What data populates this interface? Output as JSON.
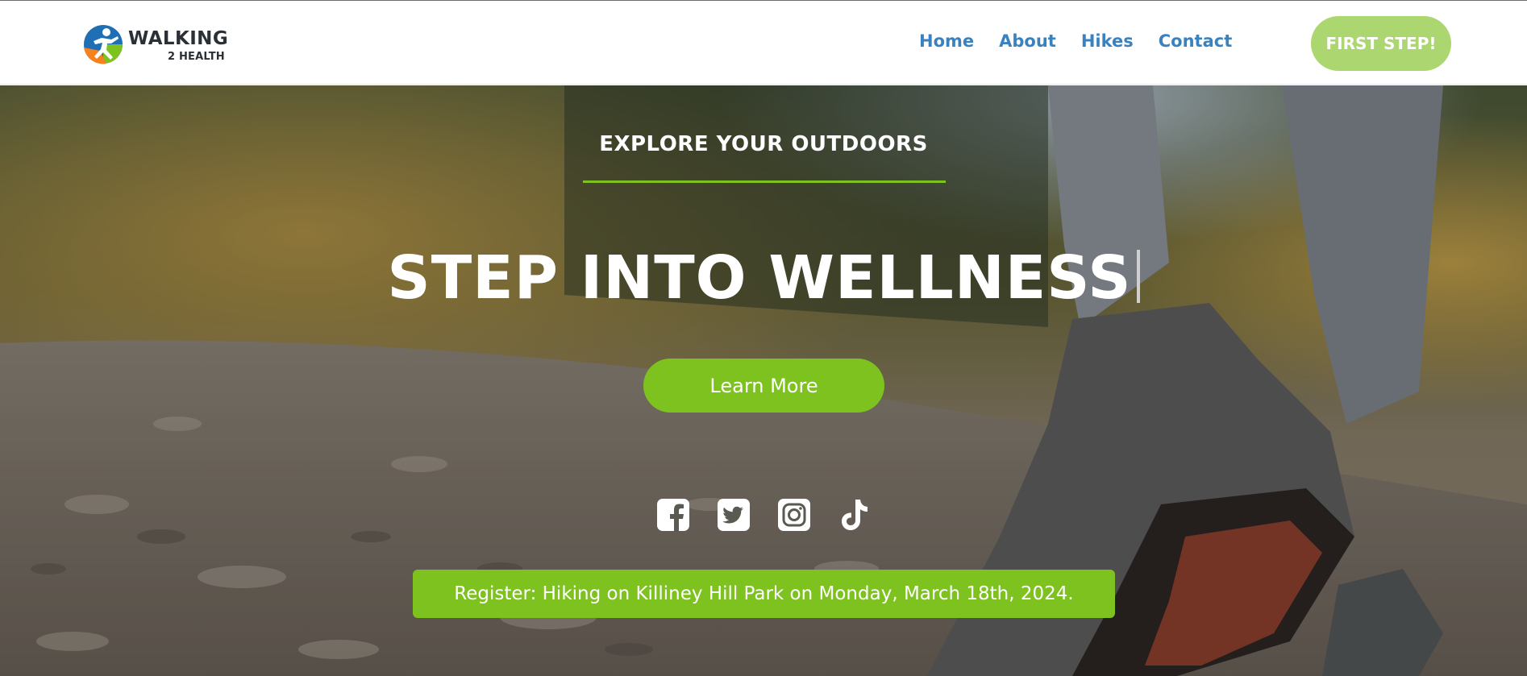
{
  "brand": {
    "name": "WALKING",
    "tagline": "2 HEALTH",
    "colors": {
      "blue": "#1f6fb5",
      "green": "#7dc21f",
      "orange": "#f58220"
    }
  },
  "nav": {
    "items": [
      {
        "label": "Home"
      },
      {
        "label": "About"
      },
      {
        "label": "Hikes"
      },
      {
        "label": "Contact"
      }
    ],
    "link_color": "#3a82bf"
  },
  "cta": {
    "label": "FIRST STEP!",
    "color": "#acd66f"
  },
  "hero": {
    "eyebrow": "EXPLORE YOUR OUTDOORS",
    "headline": "STEP INTO WELLNESS",
    "button_label": "Learn More",
    "accent_color": "#7dc21f",
    "socials": [
      {
        "icon": "facebook-icon"
      },
      {
        "icon": "twitter-icon"
      },
      {
        "icon": "instagram-icon"
      },
      {
        "icon": "tiktok-icon"
      }
    ],
    "register_label": "Register: Hiking on Killiney Hill Park on Monday, March 18th, 2024."
  }
}
